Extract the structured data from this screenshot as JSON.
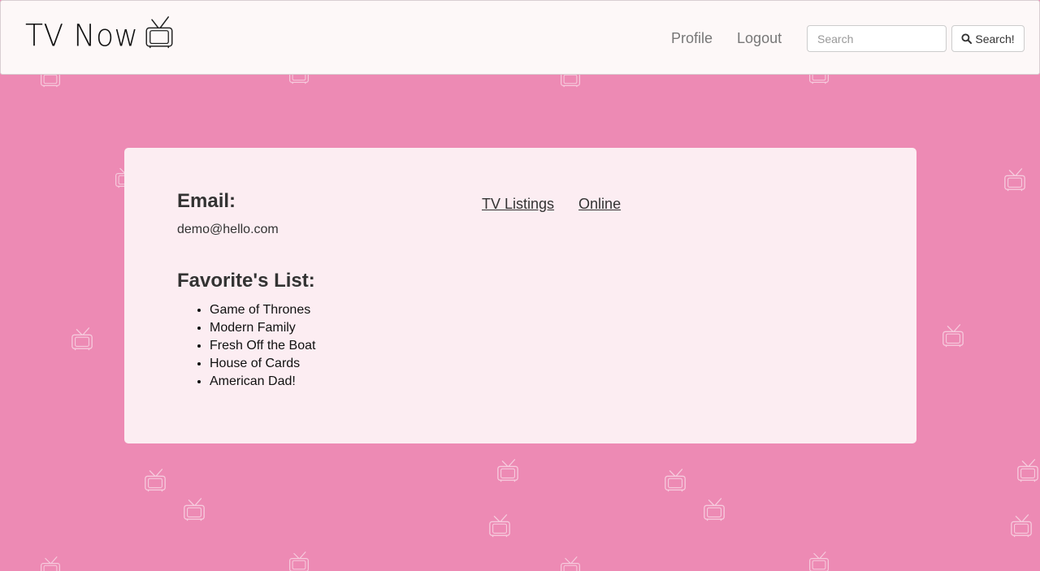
{
  "brand": {
    "name": "TV Now",
    "icon": "tv-icon"
  },
  "nav": {
    "profile": "Profile",
    "logout": "Logout"
  },
  "search": {
    "placeholder": "Search",
    "button_label": "Search!",
    "button_icon": "search-icon"
  },
  "profile": {
    "email_heading": "Email:",
    "email_value": "demo@hello.com",
    "favorites_heading": "Favorite's List:",
    "favorites": [
      "Game of Thrones",
      "Modern Family",
      "Fresh Off the Boat",
      "House of Cards",
      "American Dad!"
    ]
  },
  "tabs": [
    {
      "label": "TV Listings"
    },
    {
      "label": "Online"
    }
  ],
  "colors": {
    "background": "#ed8ab4",
    "card": "#fcedf2",
    "navbar": "#fdf8f8"
  }
}
